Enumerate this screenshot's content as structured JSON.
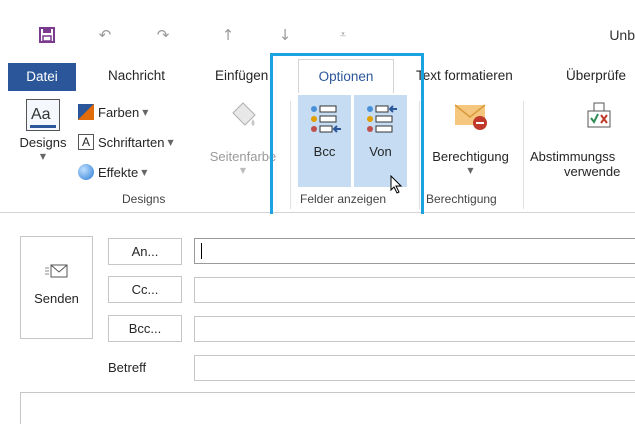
{
  "title_text": "Unb",
  "tabs": {
    "file": "Datei",
    "message": "Nachricht",
    "insert": "Einfügen",
    "options": "Optionen",
    "format_text": "Text formatieren",
    "review": "Überprüfe"
  },
  "ribbon": {
    "designs_button": "Designs",
    "colors": "Farben",
    "fonts": "Schriftarten",
    "effects": "Effekte",
    "page_color": "Seitenfarbe",
    "designs_group": "Designs",
    "bcc": "Bcc",
    "from": "Von",
    "show_fields_group": "Felder anzeigen",
    "permission": "Berechtigung",
    "permission_group": "Berechtigung",
    "voting_line1": "Abstimmungss",
    "voting_line2": "verwende"
  },
  "compose": {
    "send": "Senden",
    "to": "An...",
    "cc": "Cc...",
    "bcc": "Bcc...",
    "subject": "Betreff"
  },
  "colors": {
    "accent": "#2b579a",
    "highlight_frame": "#1aa3e0",
    "selected_button": "#c5dcf3"
  }
}
